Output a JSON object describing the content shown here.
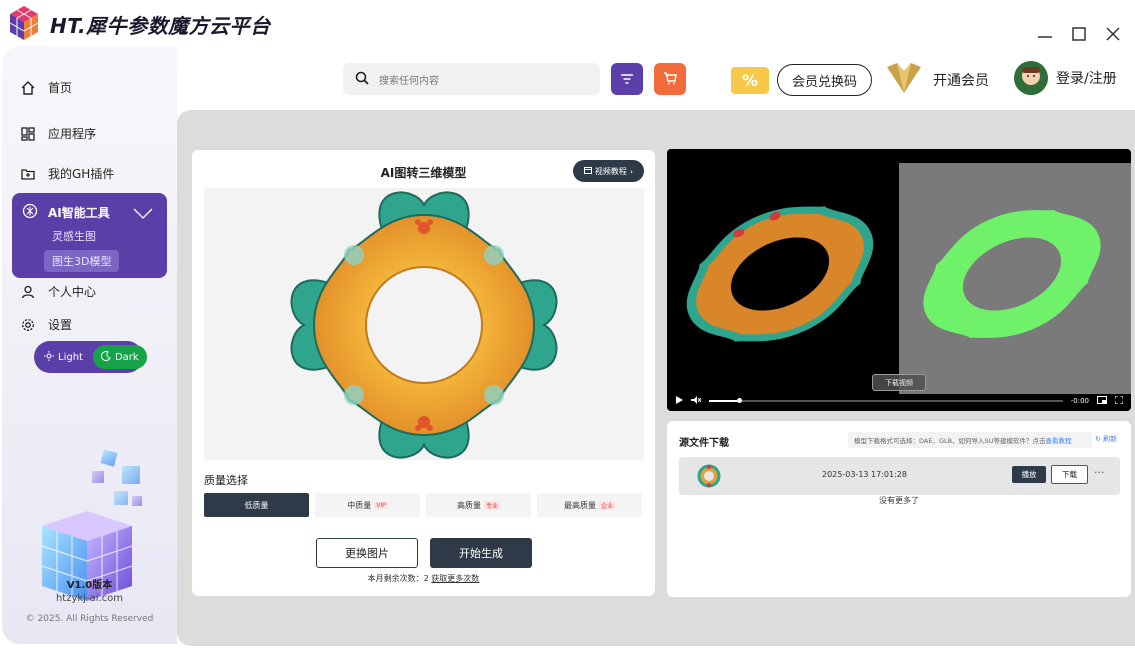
{
  "app": {
    "title": "HT.犀牛参数魔方云平台"
  },
  "window": {
    "min": "—",
    "max": "☐",
    "close": "✕"
  },
  "sidebar": {
    "items": [
      {
        "label": "首页",
        "icon": "home-icon"
      },
      {
        "label": "应用程序",
        "icon": "apps-grid-icon"
      },
      {
        "label": "我的GH插件",
        "icon": "folder-plugin-icon"
      },
      {
        "label": "个人中心",
        "icon": "user-icon"
      },
      {
        "label": "设置",
        "icon": "gear-icon"
      }
    ],
    "ai_group": {
      "label": "AI智能工具",
      "sub1": "灵感生图",
      "sub2": "图生3D模型"
    },
    "theme": {
      "light": "Light",
      "dark": "Dark",
      "active": "Dark"
    },
    "version": "V1.0版本",
    "site": "htzykj-ai.com",
    "copyright": "© 2025. All Rights Reserved"
  },
  "topbar": {
    "search_placeholder": "搜索任何内容",
    "filter_color": "#5b3fa8",
    "cart_color": "#f26b3a",
    "redeem_label": "会员兑换码",
    "vip_label": "开通会员",
    "login_label": "登录/注册"
  },
  "left_card": {
    "title": "AI图转三维模型",
    "tutorial": "视频教程",
    "quality_label": "质量选择",
    "quality_options": [
      {
        "label": "低质量",
        "tag": "",
        "selected": true
      },
      {
        "label": "中质量",
        "tag": "VIP",
        "selected": false
      },
      {
        "label": "高质量",
        "tag": "专业",
        "selected": false
      },
      {
        "label": "最高质量",
        "tag": "企业",
        "selected": false
      }
    ],
    "change_btn": "更换图片",
    "start_btn": "开始生成",
    "remain_prefix": "本月剩余次数：2",
    "remain_link": "获取更多次数"
  },
  "video": {
    "download_label": "下载视频",
    "time": "-0:00"
  },
  "source_card": {
    "title": "源文件下载",
    "hint": "模型下载格式可选择：DAE、GLB，如何导入SU等建模软件？点击",
    "hint_link": "查看教程",
    "refresh": "刷新",
    "rows": [
      {
        "date": "2025-03-13 17:01:28",
        "play": "播放",
        "download": "下载",
        "more": "···"
      }
    ],
    "empty": "没有更多了"
  }
}
